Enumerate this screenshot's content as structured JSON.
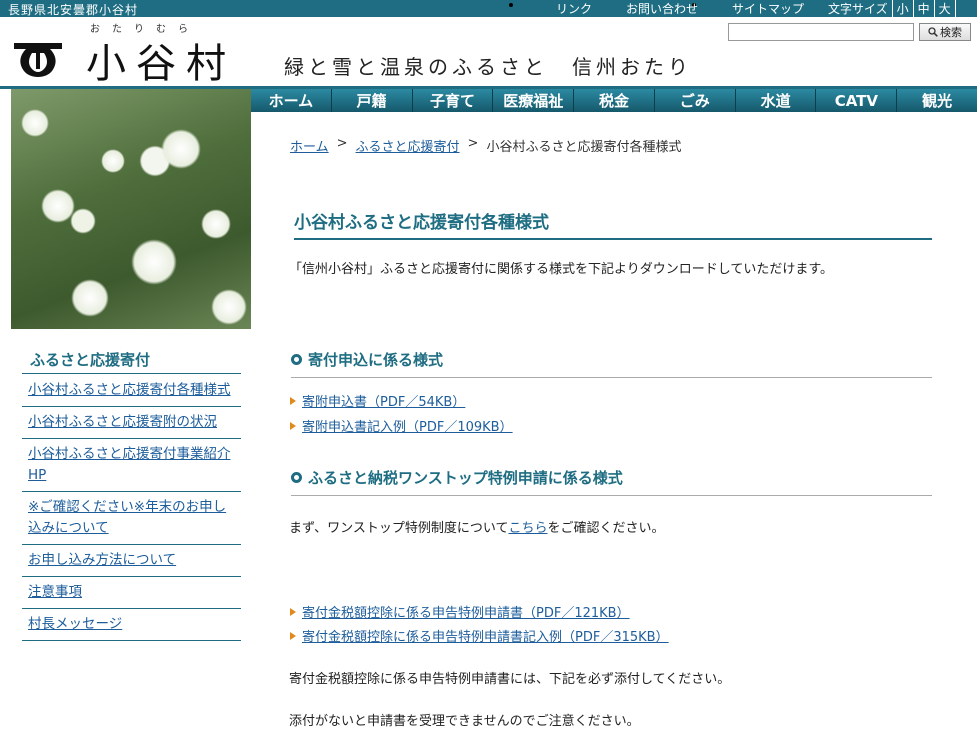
{
  "topbar": {
    "prefecture": "長野県北安曇郡小谷村",
    "links": [
      "リンク",
      "お問い合わせ",
      "サイトマップ"
    ],
    "font_size_label": "文字サイズ",
    "font_sizes": [
      "小",
      "中",
      "大"
    ]
  },
  "header": {
    "ruby": "おたりむら",
    "site_name": "小谷村",
    "tagline": "緑と雪と温泉のふるさと　信州おたり",
    "search_placeholder": "",
    "search_button": "検索"
  },
  "global_nav": [
    "ホーム",
    "戸籍",
    "子育て",
    "医療福祉",
    "税金",
    "ごみ",
    "水道",
    "CATV",
    "観光"
  ],
  "side_nav": {
    "title": "ふるさと応援寄付",
    "items": [
      "小谷村ふるさと応援寄付各種様式",
      "小谷村ふるさと応援寄附の状況",
      "小谷村ふるさと応援寄付事業紹介HP",
      "※ご確認ください※年末のお申し込みについて",
      "お申し込み方法について",
      "注意事項",
      "村長メッセージ"
    ]
  },
  "breadcrumb": {
    "home": "ホーム",
    "parent": "ふるさと応援寄付",
    "current": "小谷村ふるさと応援寄付各種様式",
    "sep": ">"
  },
  "main": {
    "title": "小谷村ふるさと応援寄付各種様式",
    "intro": "「信州小谷村」ふるさと応援寄付に関係する様式を下記よりダウンロードしていただけます。",
    "section1": {
      "title": "寄付申込に係る様式",
      "links": [
        "寄附申込書（PDF／54KB）",
        "寄附申込書記入例（PDF／109KB）"
      ]
    },
    "section2": {
      "title": "ふるさと納税ワンストップ特例申請に係る様式",
      "note_before": "まず、ワンストップ特例制度について",
      "note_link": "こちら",
      "note_after": "をご確認ください。",
      "links": [
        "寄付金税額控除に係る申告特例申請書（PDF／121KB）",
        "寄付金税額控除に係る申告特例申請書記入例（PDF／315KB）"
      ],
      "text1": "寄付金税額控除に係る申告特例申請書には、下記を必ず添付してください。",
      "text2": "添付がないと申請書を受理できませんのでご注意ください。"
    }
  },
  "colors": {
    "brand": "#1e6d82",
    "link": "#1d5d9b",
    "bullet": "#e08a1e"
  }
}
